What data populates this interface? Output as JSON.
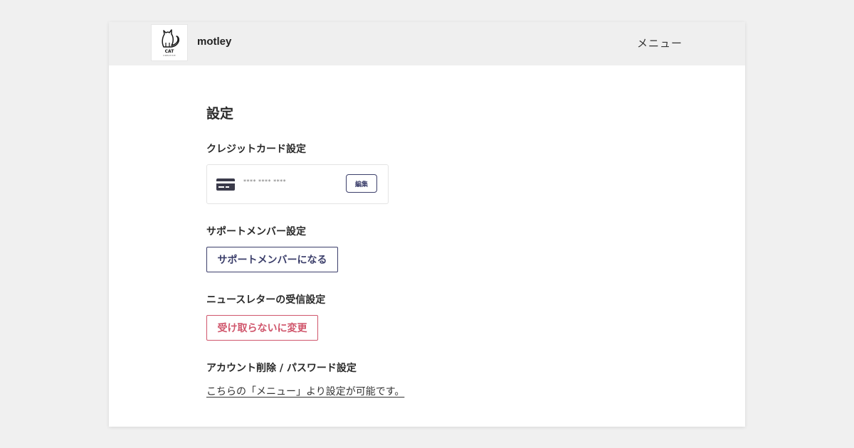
{
  "header": {
    "logo_text": "CAT",
    "logo_subtext": "CREATIVE",
    "site_name": "motley",
    "menu_label": "メニュー"
  },
  "page": {
    "title": "設定"
  },
  "credit_card": {
    "title": "クレジットカード設定",
    "masked_number": "**** **** ****",
    "edit_label": "編集"
  },
  "support_member": {
    "title": "サポートメンバー設定",
    "button_label": "サポートメンバーになる"
  },
  "newsletter": {
    "title": "ニュースレターの受信設定",
    "button_label": "受け取らないに変更"
  },
  "account": {
    "title": "アカウント削除 / パスワード設定",
    "link_text": "こちらの「メニュー」より設定が可能です。"
  },
  "colors": {
    "background": "#f0f0f0",
    "header_bg": "#efefef",
    "primary_navy": "#3c3f6b",
    "accent_pink": "#d0566c"
  },
  "icons": {
    "logo": "cat-logo-icon",
    "credit_card": "credit-card-icon"
  }
}
